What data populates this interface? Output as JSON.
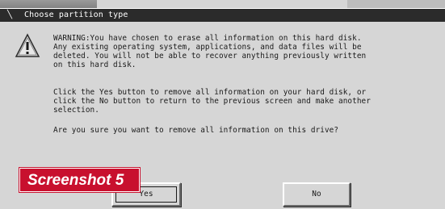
{
  "dialog": {
    "title": "Choose partition type",
    "message_1": "WARNING:You have chosen to erase all information on this hard disk.\nAny existing operating system, applications, and data files will be\ndeleted. You will not be able to recover anything previously written\non this hard disk.",
    "message_2": "Click the Yes button to remove all information on your hard disk, or\nclick the No button to return to the previous screen and make another\nselection.",
    "message_3": "Are you sure you want to remove all information on this drive?",
    "yes_label": "Yes",
    "no_label": "No",
    "icon": "warning-icon"
  },
  "caption": {
    "label": "Screenshot 5",
    "color": "#c8102e"
  }
}
